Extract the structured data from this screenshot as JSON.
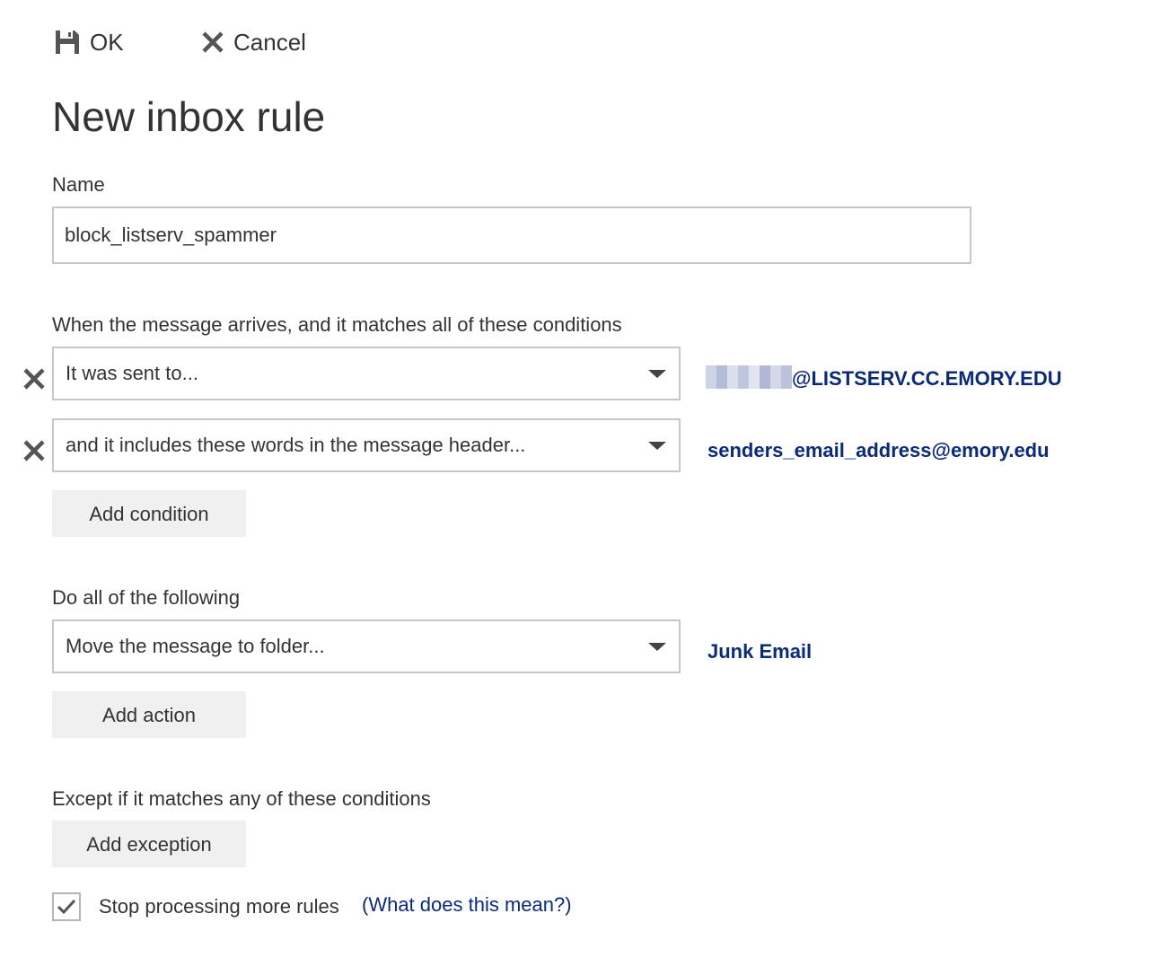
{
  "toolbar": {
    "ok_label": "OK",
    "cancel_label": "Cancel"
  },
  "page": {
    "title": "New inbox rule"
  },
  "name_section": {
    "label": "Name",
    "value": "block_listserv_spammer"
  },
  "conditions_section": {
    "label": "When the message arrives, and it matches all of these conditions",
    "conditions": [
      {
        "selected": "It was sent to...",
        "value_redacted": true,
        "value": "@LISTSERV.CC.EMORY.EDU"
      },
      {
        "selected": "and it includes these words in the message header...",
        "value": "senders_email_address@emory.edu"
      }
    ],
    "add_button_label": "Add condition"
  },
  "actions_section": {
    "label": "Do all of the following",
    "actions": [
      {
        "selected": "Move the message to folder...",
        "value": "Junk Email"
      }
    ],
    "add_button_label": "Add action"
  },
  "exceptions_section": {
    "label": "Except if it matches any of these conditions",
    "add_button_label": "Add exception"
  },
  "stop_processing": {
    "checked": true,
    "label": "Stop processing more rules",
    "help_link": "(What does this mean?)"
  },
  "colors": {
    "link": "#0b2a78",
    "text": "#333333",
    "button_bg": "#f0f0f0",
    "border": "#c8c8c8"
  },
  "icons": {
    "ok": "save-icon",
    "cancel": "close-icon",
    "remove": "remove-x-icon",
    "dropdown": "chevron-down-icon",
    "checkbox": "checkmark-icon"
  }
}
